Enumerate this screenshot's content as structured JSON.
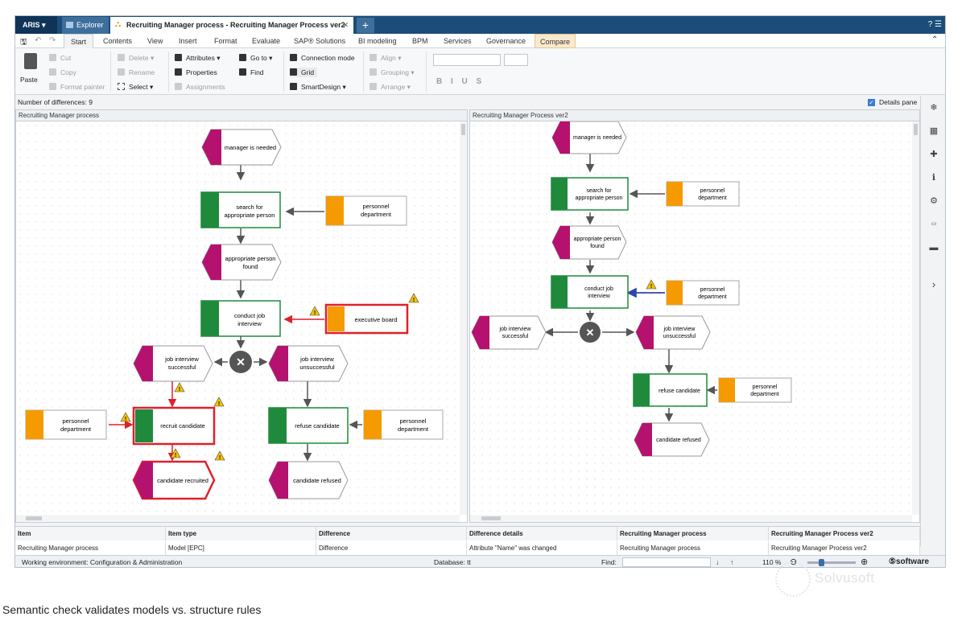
{
  "titlebar": {
    "aris_label": "ARIS",
    "explorer_tab": "Explorer",
    "active_tab": "Recruiting Manager process - Recruiting Manager Process ver2",
    "right_icons": "? ☰"
  },
  "menu": [
    "Start",
    "Contents",
    "View",
    "Insert",
    "Format",
    "Evaluate",
    "SAP® Solutions",
    "BI modeling",
    "BPM",
    "Services",
    "Governance",
    "Compare"
  ],
  "ribbon": {
    "paste": "Paste",
    "cut": "Cut",
    "copy": "Copy",
    "format_painter": "Format painter",
    "delete": "Delete",
    "rename": "Rename",
    "select": "Select",
    "attributes": "Attributes",
    "properties": "Properties",
    "assignments": "Assignments",
    "goto": "Go to",
    "find": "Find",
    "connection_mode": "Connection mode",
    "grid": "Grid",
    "smartdesign": "SmartDesign",
    "align": "Align",
    "grouping": "Grouping",
    "arrange": "Arrange",
    "format_buttons": "B I U S"
  },
  "compare": {
    "differences": "Number of differences: 9",
    "details_pane": "Details pane",
    "left_title": "Recruiting Manager process",
    "right_title": "Recruiting Manager Process ver2"
  },
  "left_model": {
    "manager_needed": [
      "manager is needed"
    ],
    "search": [
      "search for",
      "appropriate person"
    ],
    "personnel1": [
      "personnel",
      "department"
    ],
    "found": [
      "appropriate person",
      "found"
    ],
    "conduct": [
      "conduct job",
      "interview"
    ],
    "exec_board": [
      "executive board"
    ],
    "jis": [
      "job interview",
      "successful"
    ],
    "jiu": [
      "job interview",
      "unsuccessful"
    ],
    "recruit": [
      "recruit candidate"
    ],
    "personnel2": [
      "personnel",
      "department"
    ],
    "refuse": [
      "refuse candidate"
    ],
    "personnel3": [
      "personnel",
      "department"
    ],
    "recruited": [
      "candidate recruited"
    ],
    "refused": [
      "candidate refused"
    ]
  },
  "right_model": {
    "manager_needed": [
      "manager is needed"
    ],
    "search": [
      "search for",
      "appropriate person"
    ],
    "personnel1": [
      "personnel",
      "department"
    ],
    "found": [
      "appropriate person",
      "found"
    ],
    "conduct": [
      "conduct job",
      "interview"
    ],
    "personnel2": [
      "personnel",
      "department"
    ],
    "jis": [
      "job interview",
      "successful"
    ],
    "jiu": [
      "job interview",
      "unsuccessful"
    ],
    "refuse": [
      "refuse candidate"
    ],
    "personnel3": [
      "personnel",
      "department"
    ],
    "refused": [
      "candidate refused"
    ]
  },
  "table": {
    "headers": [
      "Item",
      "Item type",
      "Difference",
      "Difference details",
      "Recruiting Manager process",
      "Recruiting Manager Process ver2"
    ],
    "rows": [
      [
        "Recruiting Manager process",
        "Model [EPC]",
        "Difference",
        "Attribute \"Name\" was changed",
        "Recruiting Manager process",
        "Recruiting Manager Process ver2"
      ]
    ]
  },
  "statusbar": {
    "environment": "Working environment: Configuration & Administration",
    "database": "Database: tt",
    "find": "Find:",
    "zoom": "110 %",
    "brand": "software"
  },
  "caption": "Semantic check validates models vs. structure rules",
  "watermark": "Solvusoft",
  "colors": {
    "event": "#b5126f",
    "function": "#1f8a3c",
    "org": "#f59a00",
    "highlight": "#e0202a",
    "changed_edge": "#2f46a8",
    "titlebar": "#1c4d7a"
  }
}
